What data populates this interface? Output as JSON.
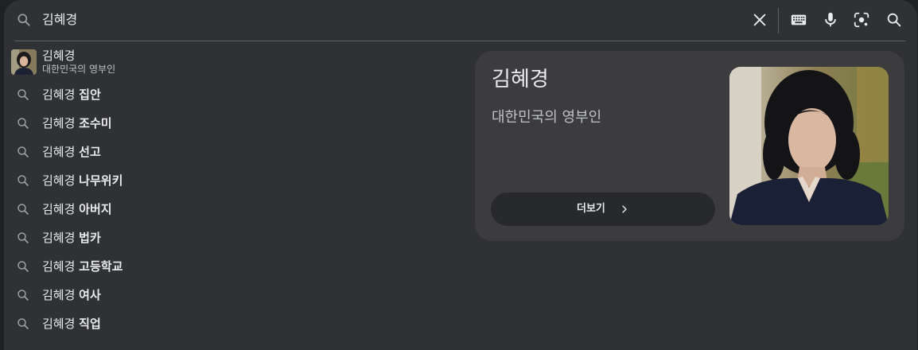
{
  "search": {
    "query": "김혜경"
  },
  "toolbar": {
    "icons": [
      "search-icon",
      "clear-icon",
      "keyboard-icon",
      "microphone-icon",
      "lens-icon",
      "search-submit-icon"
    ]
  },
  "suggestions": {
    "top": {
      "title": "김혜경",
      "subtitle": "대한민국의 영부인"
    },
    "items": [
      {
        "base": "김혜경 ",
        "bold": "집안"
      },
      {
        "base": "김혜경 ",
        "bold": "조수미"
      },
      {
        "base": "김혜경 ",
        "bold": "선고"
      },
      {
        "base": "김혜경 ",
        "bold": "나무위키"
      },
      {
        "base": "김혜경 ",
        "bold": "아버지"
      },
      {
        "base": "김혜경 ",
        "bold": "법카"
      },
      {
        "base": "김혜경 ",
        "bold": "고등학교"
      },
      {
        "base": "김혜경 ",
        "bold": "여사"
      },
      {
        "base": "김혜경 ",
        "bold": "직업"
      }
    ]
  },
  "knowledge_panel": {
    "title": "김혜경",
    "subtitle": "대한민국의 영부인",
    "more_label": "더보기"
  },
  "colors": {
    "background": "#202124",
    "panel": "#303134",
    "card": "#3c3c3f",
    "text": "#e8eaed",
    "muted": "#9aa0a6"
  }
}
